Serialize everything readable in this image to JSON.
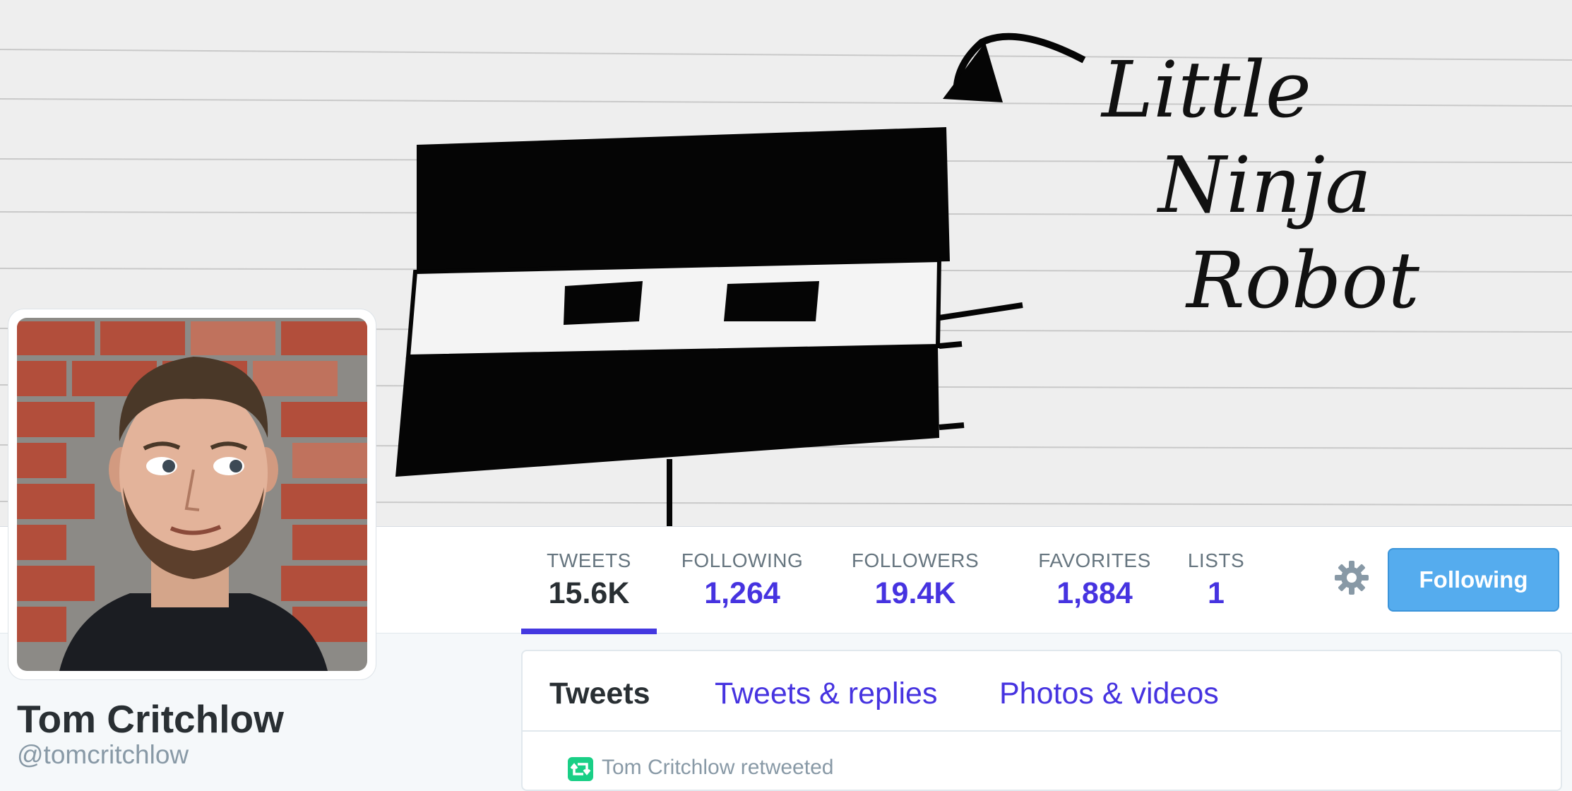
{
  "profile": {
    "name": "Tom Critchlow",
    "handle": "@tomcritchlow"
  },
  "header": {
    "caption_lines": [
      "Little",
      "Ninja",
      "Robot"
    ]
  },
  "stats": [
    {
      "label": "TWEETS",
      "value": "15.6K",
      "active": true
    },
    {
      "label": "FOLLOWING",
      "value": "1,264"
    },
    {
      "label": "FOLLOWERS",
      "value": "19.4K"
    },
    {
      "label": "FAVORITES",
      "value": "1,884"
    },
    {
      "label": "LISTS",
      "value": "1"
    }
  ],
  "actions": {
    "follow_label": "Following"
  },
  "timeline": {
    "tabs": [
      {
        "label": "Tweets",
        "active": true
      },
      {
        "label": "Tweets & replies"
      },
      {
        "label": "Photos & videos"
      }
    ],
    "retweet_context": "Tom Critchlow retweeted"
  },
  "icons": {
    "settings": "gear-icon",
    "retweet": "retweet-icon"
  },
  "colors": {
    "accent": "#4633e0",
    "button": "#55acee",
    "retweet": "#19cf86"
  }
}
